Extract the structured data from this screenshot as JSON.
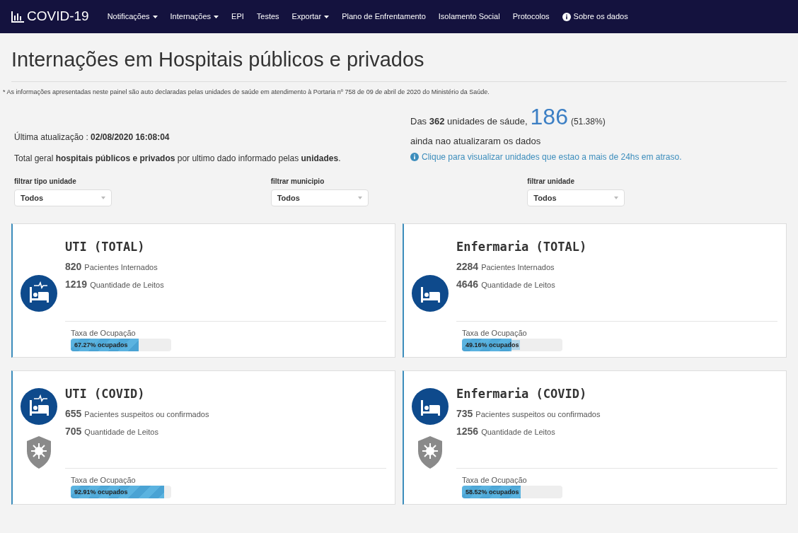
{
  "navbar": {
    "brand": "COVID-19",
    "items": [
      {
        "label": "Notificações",
        "kind": "dropdown"
      },
      {
        "label": "Internações",
        "kind": "dropdown"
      },
      {
        "label": "EPI",
        "kind": "link"
      },
      {
        "label": "Testes",
        "kind": "link"
      },
      {
        "label": "Exportar",
        "kind": "dropdown"
      },
      {
        "label": "Plano de Enfrentamento",
        "kind": "link"
      },
      {
        "label": "Isolamento Social",
        "kind": "link"
      },
      {
        "label": "Protocolos",
        "kind": "link"
      },
      {
        "label": "Sobre os dados",
        "kind": "info"
      }
    ]
  },
  "page_title": "Internações em Hospitais públicos e privados",
  "disclaimer": "* As informações apresentadas neste painel são auto declaradas pelas unidades de saúde em atendimento à Portaria nº 758 de 09 de abril de 2020 do Ministério da Saúde.",
  "last_update": "Última atualização : **02/08/2020 16:08:04**",
  "total_note": "Total geral **hospitais públicos e privados** por ultimo dado informado pelas **unidades**.",
  "units_summary": {
    "prefix": "Das **362** unidades de sáude,",
    "count": "186",
    "percent": "(51.38%)",
    "text": "ainda nao atualizaram os dados",
    "link": "Clique para visualizar unidades que estao a mais de 24hs em atraso."
  },
  "filters": [
    {
      "label": "filtrar tipo unidade",
      "value": "Todos"
    },
    {
      "label": "filtrar municipio",
      "value": "Todos"
    },
    {
      "label": "filtrar unidade",
      "value": "Todos"
    }
  ],
  "cards": [
    {
      "title": "UTI (TOTAL)",
      "kind": "total",
      "monitor": true,
      "patients": "820",
      "patients_label": "Pacientes Internados",
      "beds": "1219",
      "beds_label": "Quantidade de Leitos",
      "rate_label": "Taxa de Ocupação",
      "level": 0.6727,
      "reading": "67.27% ocupados"
    },
    {
      "title": "Enfermaria (TOTAL)",
      "kind": "total",
      "monitor": false,
      "patients": "2284",
      "patients_label": "Pacientes Internados",
      "beds": "4646",
      "beds_label": "Quantidade de Leitos",
      "rate_label": "Taxa de Ocupação",
      "level": 0.4916,
      "reading": "49.16% ocupados"
    },
    {
      "title": "UTI (COVID)",
      "kind": "covid",
      "monitor": true,
      "patients": "655",
      "patients_label": "Pacientes suspeitos ou confirmados",
      "beds": "705",
      "beds_label": "Quantidade de Leitos",
      "rate_label": "Taxa de Ocupação",
      "level": 0.9291,
      "reading": "92.91% ocupados"
    },
    {
      "title": "Enfermaria (COVID)",
      "kind": "covid",
      "monitor": false,
      "patients": "735",
      "patients_label": "Pacientes suspeitos ou confirmados",
      "beds": "1256",
      "beds_label": "Quantidade de Leitos",
      "rate_label": "Taxa de Ocupação",
      "level": 0.5852,
      "reading": "58.52% ocupados"
    }
  ]
}
